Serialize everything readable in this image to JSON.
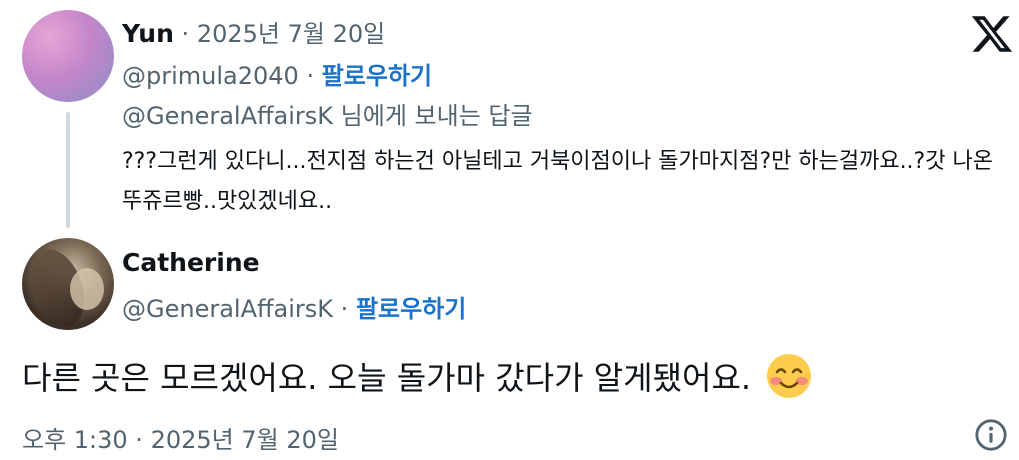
{
  "parent_tweet": {
    "display_name": "Yun",
    "separator": "·",
    "date": "2025년 7월 20일",
    "handle": "@primula2040",
    "follow_label": "팔로우하기",
    "reply_to_handle": "@GeneralAffairsK",
    "reply_to_suffix": " 님에게 보내는 답글",
    "text": "???그런게 있다니...전지점 하는건 아닐테고 거북이점이나 돌가마지점?만 하는걸까요..?갓 나온 뚜쥬르빵..맛있겠네요.."
  },
  "main_tweet": {
    "display_name": "Catherine",
    "handle": "@GeneralAffairsK",
    "separator": "·",
    "follow_label": "팔로우하기",
    "text": "다른 곳은 모르겠어요. 오늘 돌가마 갔다가 알게됐어요.",
    "emoji": "smiling-face-with-smiling-eyes",
    "timestamp": "오후 1:30 · 2025년 7월 20일"
  },
  "icons": {
    "logo": "x-logo",
    "info": "info-icon"
  },
  "colors": {
    "text": "#0f1419",
    "muted": "#536471",
    "follow": "#1a73c8",
    "thread_line": "#cfd9de"
  }
}
